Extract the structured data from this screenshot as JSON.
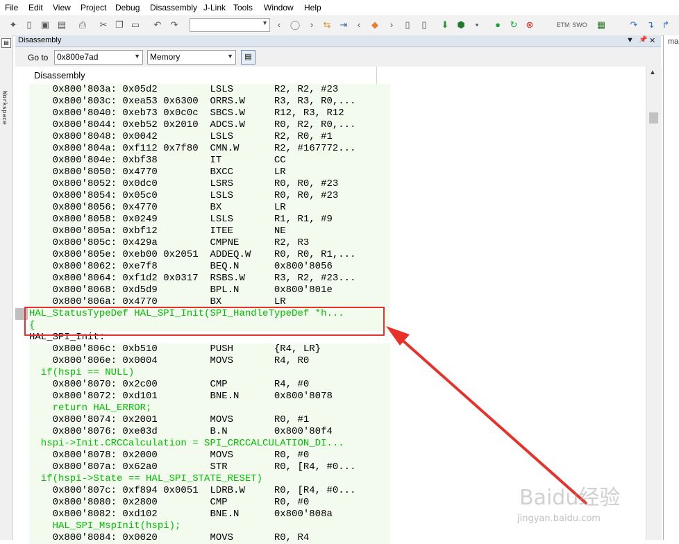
{
  "menu": [
    "File",
    "Edit",
    "View",
    "Project",
    "Debug",
    "Disassembly",
    "J-Link",
    "Tools",
    "Window",
    "Help"
  ],
  "toolbar": {
    "etm_label": "ETM",
    "swo_label": "SWO"
  },
  "workspace_label": "Workspace",
  "panel": {
    "title": "Disassembly",
    "pin_icon": "▼",
    "dock_icon": "📌",
    "close_icon": "✕"
  },
  "right_pane_label": "ma",
  "goto": {
    "label": "Go to",
    "address": "0x800e7ad",
    "memory": "Memory"
  },
  "column_header": "Disassembly",
  "lines": [
    {
      "text": "    0x800'803a: 0x05d2         LSLS       R2, R2, #23",
      "kind": "code"
    },
    {
      "text": "    0x800'803c: 0xea53 0x6300  ORRS.W     R3, R3, R0,...",
      "kind": "code"
    },
    {
      "text": "    0x800'8040: 0xeb73 0x0c0c  SBCS.W     R12, R3, R12",
      "kind": "code"
    },
    {
      "text": "    0x800'8044: 0xeb52 0x2010  ADCS.W     R0, R2, R0,...",
      "kind": "code"
    },
    {
      "text": "    0x800'8048: 0x0042         LSLS       R2, R0, #1",
      "kind": "code"
    },
    {
      "text": "    0x800'804a: 0xf112 0x7f80  CMN.W      R2, #167772...",
      "kind": "code"
    },
    {
      "text": "    0x800'804e: 0xbf38         IT         CC",
      "kind": "code"
    },
    {
      "text": "    0x800'8050: 0x4770         BXCC       LR",
      "kind": "code"
    },
    {
      "text": "    0x800'8052: 0x0dc0         LSRS       R0, R0, #23",
      "kind": "code"
    },
    {
      "text": "    0x800'8054: 0x05c0         LSLS       R0, R0, #23",
      "kind": "code"
    },
    {
      "text": "    0x800'8056: 0x4770         BX         LR",
      "kind": "code"
    },
    {
      "text": "    0x800'8058: 0x0249         LSLS       R1, R1, #9",
      "kind": "code"
    },
    {
      "text": "    0x800'805a: 0xbf12         ITEE       NE",
      "kind": "code"
    },
    {
      "text": "    0x800'805c: 0x429a         CMPNE      R2, R3",
      "kind": "code"
    },
    {
      "text": "    0x800'805e: 0xeb00 0x2051  ADDEQ.W    R0, R0, R1,...",
      "kind": "code"
    },
    {
      "text": "    0x800'8062: 0xe7f8         BEQ.N      0x800'8056",
      "kind": "code"
    },
    {
      "text": "    0x800'8064: 0xf1d2 0x0317  RSBS.W     R3, R2, #23...",
      "kind": "code"
    },
    {
      "text": "    0x800'8068: 0xd5d9         BPL.N      0x800'801e",
      "kind": "code"
    },
    {
      "text": "    0x800'806a: 0x4770         BX         LR",
      "kind": "code"
    },
    {
      "text": "HAL_StatusTypeDef HAL_SPI_Init(SPI_HandleTypeDef *h...",
      "kind": "src"
    },
    {
      "text": "{",
      "kind": "src"
    },
    {
      "text": "HAL_SPI_Init:",
      "kind": "label"
    },
    {
      "text": "    0x800'806c: 0xb510         PUSH       {R4, LR}",
      "kind": "code"
    },
    {
      "text": "    0x800'806e: 0x0004         MOVS       R4, R0",
      "kind": "code"
    },
    {
      "text": "  if(hspi == NULL)",
      "kind": "src"
    },
    {
      "text": "    0x800'8070: 0x2c00         CMP        R4, #0",
      "kind": "code"
    },
    {
      "text": "    0x800'8072: 0xd101         BNE.N      0x800'8078",
      "kind": "code"
    },
    {
      "text": "    return HAL_ERROR;",
      "kind": "src"
    },
    {
      "text": "    0x800'8074: 0x2001         MOVS       R0, #1",
      "kind": "code"
    },
    {
      "text": "    0x800'8076: 0xe03d         B.N        0x800'80f4",
      "kind": "code"
    },
    {
      "text": "  hspi->Init.CRCCalculation = SPI_CRCCALCULATION_DI...",
      "kind": "src"
    },
    {
      "text": "    0x800'8078: 0x2000         MOVS       R0, #0",
      "kind": "code"
    },
    {
      "text": "    0x800'807a: 0x62a0         STR        R0, [R4, #0...",
      "kind": "code"
    },
    {
      "text": "  if(hspi->State == HAL_SPI_STATE_RESET)",
      "kind": "src"
    },
    {
      "text": "    0x800'807c: 0xf894 0x0051  LDRB.W     R0, [R4, #0...",
      "kind": "code"
    },
    {
      "text": "    0x800'8080: 0x2800         CMP        R0, #0",
      "kind": "code"
    },
    {
      "text": "    0x800'8082: 0xd102         BNE.N      0x800'808a",
      "kind": "code"
    },
    {
      "text": "    HAL_SPI_MspInit(hspi);",
      "kind": "src"
    },
    {
      "text": "    0x800'8084: 0x0020         MOVS       R0, R4",
      "kind": "code"
    }
  ],
  "watermark": {
    "logo": "Baidu经验",
    "url": "jingyan.baidu.com"
  },
  "colors": {
    "source_line": "#00c000",
    "code_bg": "#f3fbee",
    "highlight_box": "#e8312a"
  }
}
